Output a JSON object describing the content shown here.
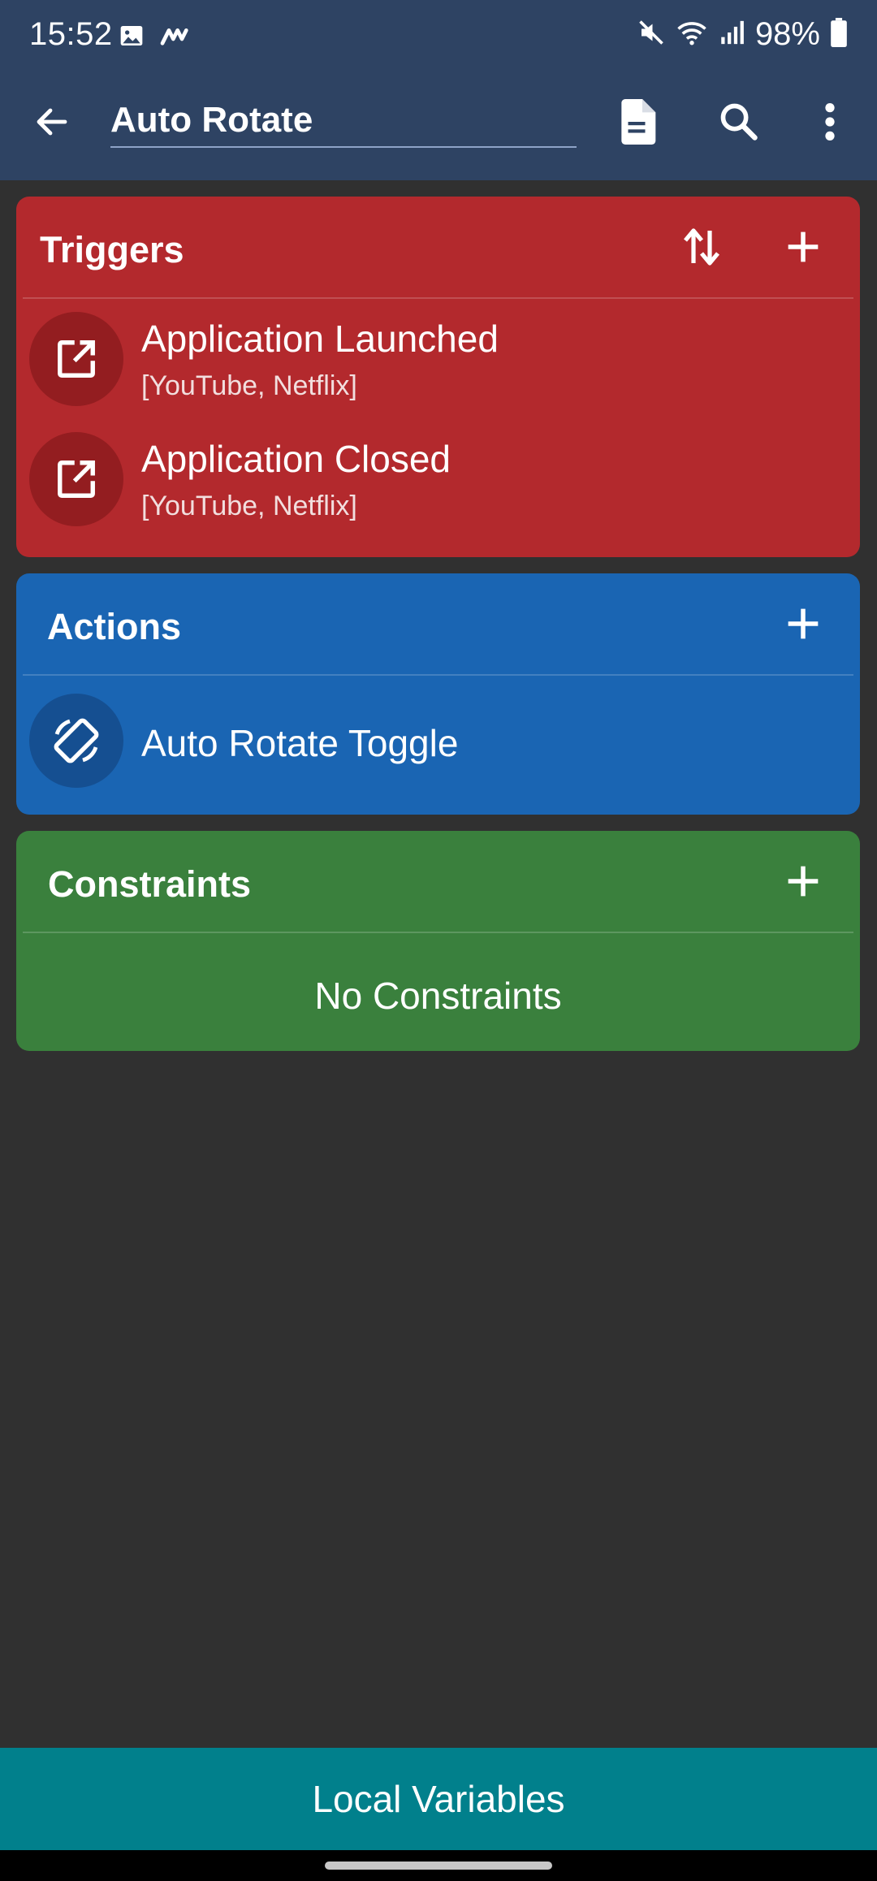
{
  "status_bar": {
    "time": "15:52",
    "battery": "98%",
    "icons": [
      "image-icon",
      "app-notification-icon",
      "mute-icon",
      "wifi-icon",
      "signal-icon",
      "battery-icon"
    ]
  },
  "app_bar": {
    "title": "Auto Rotate",
    "icons": [
      "back-arrow-icon",
      "document-icon",
      "search-icon",
      "more-vert-icon"
    ]
  },
  "triggers": {
    "title": "Triggers",
    "items": [
      {
        "title": "Application Launched",
        "subtitle": "[YouTube, Netflix]",
        "icon": "open-in-new-icon"
      },
      {
        "title": "Application Closed",
        "subtitle": "[YouTube, Netflix]",
        "icon": "open-in-new-icon"
      }
    ]
  },
  "actions": {
    "title": "Actions",
    "items": [
      {
        "title": "Auto Rotate Toggle",
        "icon": "screen-rotation-icon"
      }
    ]
  },
  "constraints": {
    "title": "Constraints",
    "empty_text": "No Constraints"
  },
  "bottom_button": {
    "label": "Local Variables"
  },
  "colors": {
    "header": "#2e4363",
    "triggers": "#b3292d",
    "actions": "#1a65b3",
    "constraints": "#3a803d",
    "local_variables": "#01808c",
    "background": "#303030"
  }
}
